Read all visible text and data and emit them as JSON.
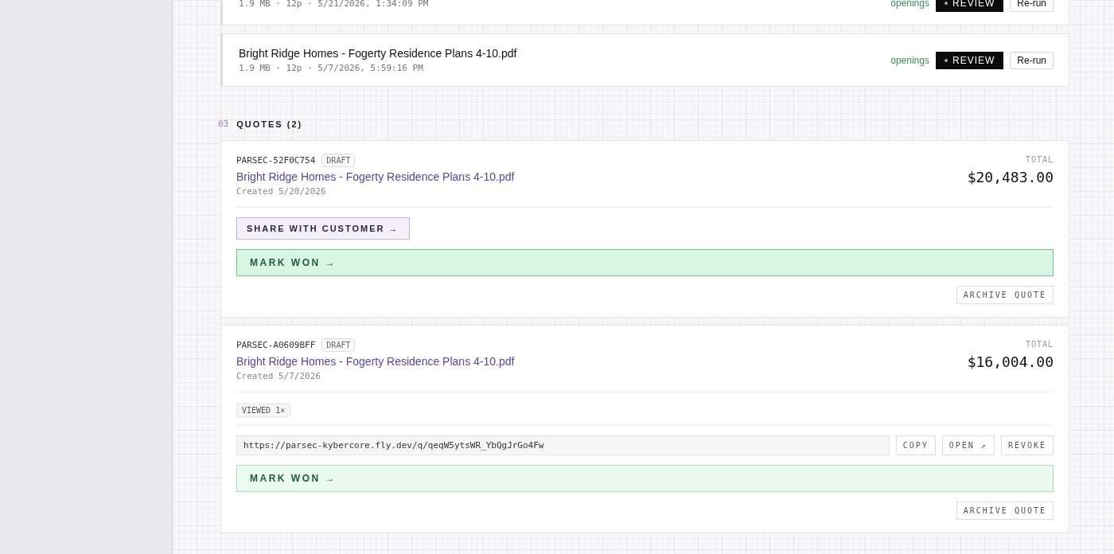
{
  "files": [
    {
      "meta": "1.9 MB · 12p · 5/21/2026, 1:34:09 PM",
      "tag": "openings",
      "review": "REVIEW",
      "rerun": "Re-run"
    },
    {
      "title": "Bright Ridge Homes - Fogerty Residence Plans 4-10.pdf",
      "meta": "1.9 MB · 12p · 5/7/2026, 5:59:16 PM",
      "tag": "openings",
      "review": "REVIEW",
      "rerun": "Re-run"
    }
  ],
  "section": {
    "number": "03",
    "title": "QUOTES (2)"
  },
  "quotes": [
    {
      "code": "PARSEC-52F0C754",
      "status": "DRAFT",
      "title": "Bright Ridge Homes - Fogerty Residence Plans 4-10.pdf",
      "created": "Created 5/20/2026",
      "total_label": "TOTAL",
      "total": "$20,483.00",
      "share": "SHARE WITH CUSTOMER →",
      "mark_won": "MARK WON →",
      "emphasized": true,
      "archive": "ARCHIVE QUOTE"
    },
    {
      "code": "PARSEC-A0609BFF",
      "status": "DRAFT",
      "title": "Bright Ridge Homes - Fogerty Residence Plans 4-10.pdf",
      "created": "Created 5/7/2026",
      "total_label": "TOTAL",
      "total": "$16,004.00",
      "viewed": "VIEWED 1×",
      "link": {
        "url": "https://parsec-kybercore.fly.dev/q/qeqW5ytsWR_YbQgJrGo4Fw",
        "actions": [
          "COPY",
          "OPEN ↗",
          "REVOKE"
        ]
      },
      "mark_won": "MARK WON →",
      "emphasized": false,
      "archive": "ARCHIVE QUOTE"
    }
  ]
}
